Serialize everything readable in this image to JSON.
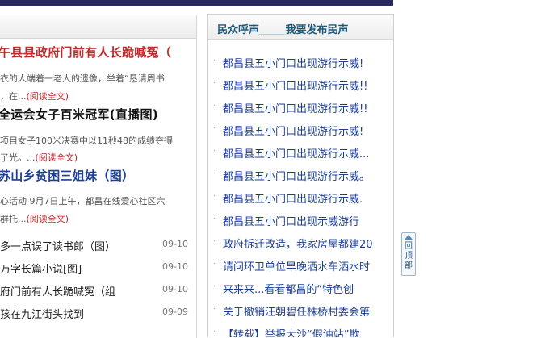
{
  "left": {
    "stories": [
      {
        "title": "午县县政府门前有人长跪喊冤（",
        "color": "#c0282a",
        "lines": [
          "衣的人端着一老人的遗像，举着“恳请周书",
          "，在..."
        ],
        "readmore": "(阅读全文)"
      },
      {
        "title": "全运会女子百米冠军(直播图)",
        "color": "#111111",
        "lines": [
          "项目女子100米决赛中以11秒48的成绩夺得",
          "了光。..."
        ],
        "readmore": "(阅读全文)"
      },
      {
        "title": "苏山乡贫困三姐妹（图）",
        "color": "#1b3f94",
        "lines": [
          "心活动   9月7日上午，都昌在线爱心社区六",
          "群托..."
        ],
        "readmore": "(阅读全文)"
      }
    ],
    "news": [
      {
        "title": "多一点误了读书郎（图）",
        "date": "09-10"
      },
      {
        "title": "万字长篇小说[图]",
        "date": "09-10"
      },
      {
        "title": "府门前有人长跪喊冤（组",
        "date": "09-10"
      },
      {
        "title": "孩在九江街头找到",
        "date": "09-09"
      }
    ]
  },
  "right": {
    "header_left": "民众呼声",
    "header_sep": "_____",
    "header_right": "我要发布民声",
    "bullet": "·",
    "items": [
      "都昌县五小门口出现游行示威!",
      "都昌县五小门口出现游行示威!!",
      "都昌县五小门口出现游行示威!!",
      "都昌县五小门口出现游行示威!",
      "都昌县五小门口出现游行示威...",
      "都昌县五小门口出现游行示威。",
      "都昌县五小门口出现游行示威.",
      "都昌县五小门口出现示威游行",
      "政府拆迁改造，我家房屋都建20",
      "请问环卫单位早晚洒水车洒水时",
      "来来来...看看都昌的“特色创",
      "关于撤销汪朝碧任株桥村委会第",
      "【转载】举报大沙“假油站”欺"
    ]
  },
  "back_to_top": {
    "label": "回顶部",
    "icon": "up-arrow-icon"
  }
}
